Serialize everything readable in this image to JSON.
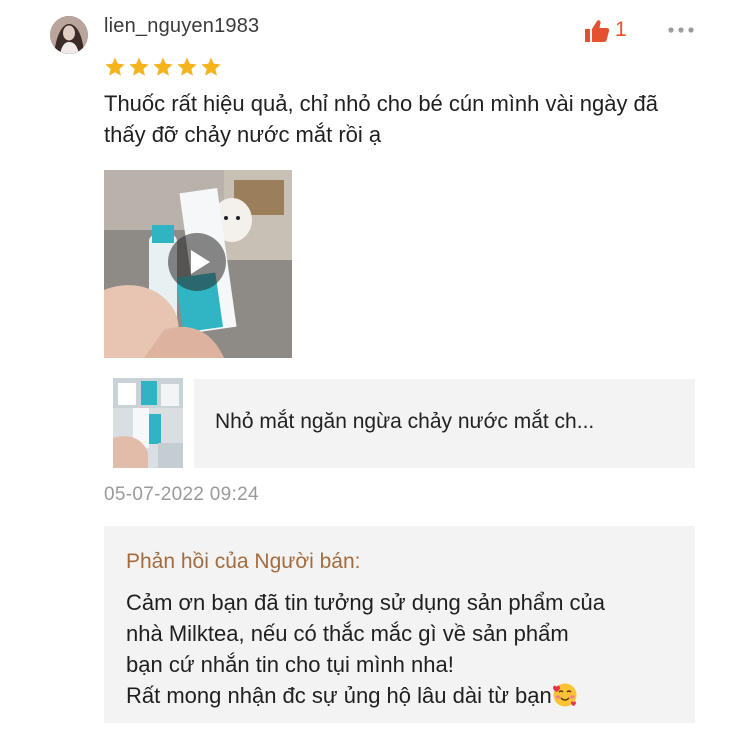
{
  "review": {
    "username": "lien_nguyen1983",
    "like_count": "1",
    "rating": 5,
    "text": "Thuốc rất hiệu quả, chỉ nhỏ cho bé cún mình vài ngày đã thấy đỡ chảy nước mắt rồi ạ",
    "timestamp": "05-07-2022 09:24"
  },
  "product": {
    "name": "Nhỏ mắt ngăn ngừa chảy nước mắt ch..."
  },
  "seller_reply": {
    "title": "Phản hồi của Người bán:",
    "lines": [
      "Cảm ơn bạn đã tin tưởng sử dụng sản phẩm của",
      "nhà Milktea, nếu có thắc mắc gì về sản phẩm",
      "bạn cứ nhắn tin cho tụi mình nha!",
      "Rất mong nhận đc sự ủng hộ lâu dài từ bạn"
    ]
  },
  "colors": {
    "star": "#f5b31c",
    "like": "#e5512f",
    "seller_title": "#a36b3e",
    "card_bg": "#f3f3f3",
    "muted_text": "#9a9a9a"
  },
  "icons": [
    "avatar",
    "thumbs-up-icon",
    "more-icon",
    "star-icon",
    "play-icon",
    "smiling-face-with-hearts-icon"
  ]
}
